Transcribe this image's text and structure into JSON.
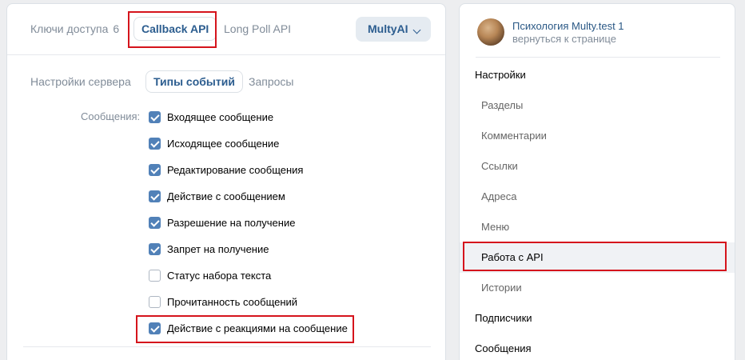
{
  "main": {
    "tabs": [
      {
        "label": "Ключи доступа",
        "count": "6"
      },
      {
        "label": "Callback API"
      },
      {
        "label": "Long Poll API"
      }
    ],
    "app_select": {
      "label": "MultyAI"
    },
    "subtabs": [
      {
        "label": "Настройки сервера"
      },
      {
        "label": "Типы событий"
      },
      {
        "label": "Запросы"
      }
    ],
    "messages_group": {
      "label": "Сообщения:",
      "items": [
        {
          "label": "Входящее сообщение",
          "checked": true
        },
        {
          "label": "Исходящее сообщение",
          "checked": true
        },
        {
          "label": "Редактирование сообщения",
          "checked": true
        },
        {
          "label": "Действие с сообщением",
          "checked": true
        },
        {
          "label": "Разрешение на получение",
          "checked": true
        },
        {
          "label": "Запрет на получение",
          "checked": true
        },
        {
          "label": "Статус набора текста",
          "checked": false
        },
        {
          "label": "Прочитанность сообщений",
          "checked": false
        },
        {
          "label": "Действие с реакциями на сообщение",
          "checked": true
        }
      ]
    }
  },
  "sidebar": {
    "community_name": "Психология Multy.test 1",
    "back_link": "вернуться к странице",
    "menu": [
      {
        "label": "Настройки",
        "level": "top"
      },
      {
        "label": "Разделы",
        "level": "sub"
      },
      {
        "label": "Комментарии",
        "level": "sub"
      },
      {
        "label": "Ссылки",
        "level": "sub"
      },
      {
        "label": "Адреса",
        "level": "sub"
      },
      {
        "label": "Меню",
        "level": "sub"
      },
      {
        "label": "Работа с API",
        "level": "sub",
        "selected": true
      },
      {
        "label": "Истории",
        "level": "sub"
      },
      {
        "label": "Подписчики",
        "level": "top"
      },
      {
        "label": "Сообщения",
        "level": "top"
      }
    ]
  },
  "colors": {
    "accent": "#2c5d8f",
    "checkbox": "#5181b8",
    "highlight": "#d5141c",
    "muted": "#818c99"
  }
}
